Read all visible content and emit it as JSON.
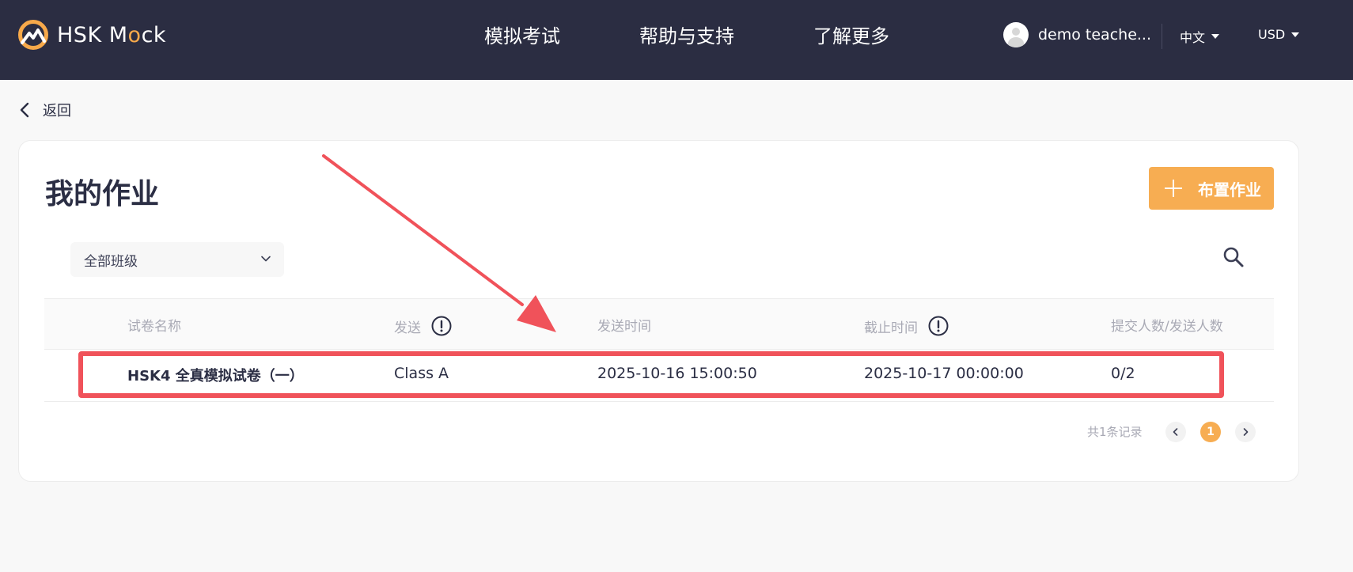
{
  "header": {
    "logo_text_before": "HSK M",
    "logo_text_o": "o",
    "logo_text_after": "ck",
    "nav": [
      "模拟考试",
      "帮助与支持",
      "了解更多"
    ],
    "user_name": "demo teache...",
    "language": "中文",
    "currency": "USD"
  },
  "back_label": "返回",
  "page": {
    "title": "我的作业",
    "add_button_label": "布置作业",
    "class_filter": "全部班级"
  },
  "table": {
    "columns": [
      "试卷名称",
      "发送",
      "发送时间",
      "截止时间",
      "提交人数/发送人数"
    ],
    "rows": [
      {
        "name": "HSK4 全真模拟试卷（一）",
        "sent_to": "Class A",
        "sent_time": "2025-10-16 15:00:50",
        "deadline": "2025-10-17 00:00:00",
        "submitted": "0/2"
      }
    ]
  },
  "pagination": {
    "total_text": "共1条记录",
    "current_page": "1"
  },
  "colors": {
    "header_bg": "#2b2d42",
    "accent": "#f7ad52",
    "annotation_red": "#f0525a"
  }
}
